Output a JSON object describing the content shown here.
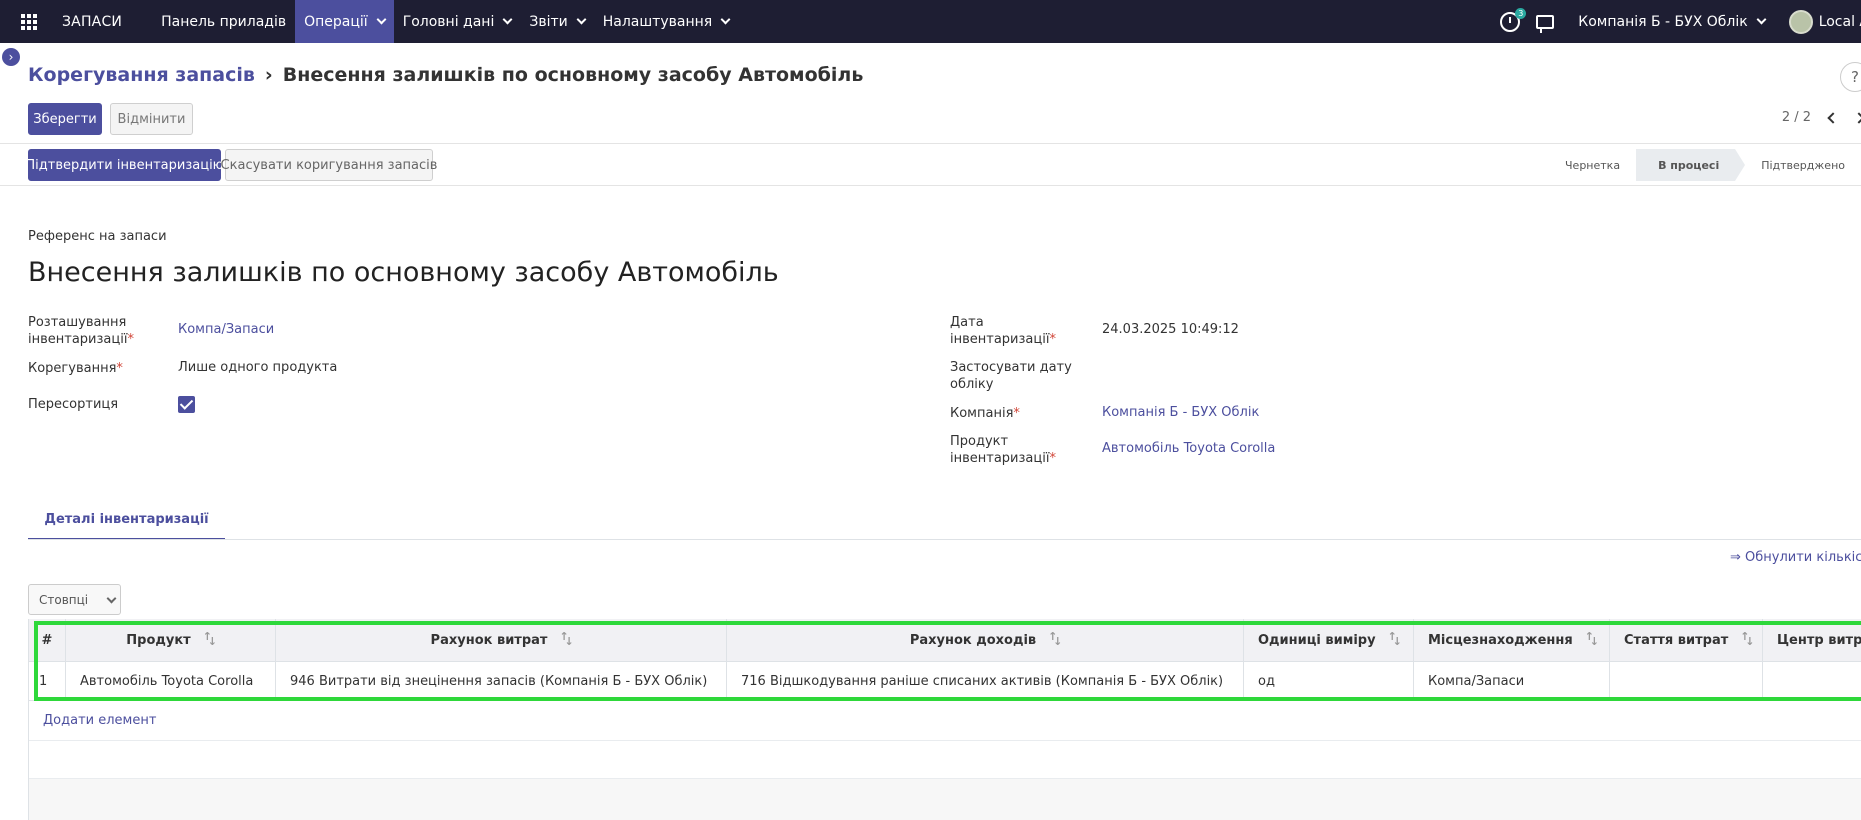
{
  "navbar": {
    "brand": "ЗАПАСИ",
    "items": [
      {
        "label": "Панель приладів"
      },
      {
        "label": "Операції"
      },
      {
        "label": "Головні дані"
      },
      {
        "label": "Звіти"
      },
      {
        "label": "Налаштування"
      }
    ],
    "activity_count": "3",
    "company": "Компанія Б - БУХ Облік",
    "user": "Local A"
  },
  "breadcrumb": {
    "parent": "Корегування запасів",
    "current": "Внесення залишків по основному засобу Автомобіль"
  },
  "buttons": {
    "save": "Зберегти",
    "discard": "Відмінити",
    "confirm": "Підтвердити інвентаризацію",
    "cancel": "Скасувати коригування запасів"
  },
  "pager": {
    "value": "2 / 2"
  },
  "status": {
    "stages": [
      "Чернетка",
      "В процесі",
      "Підтверджено"
    ],
    "current": "В процесі"
  },
  "form": {
    "ref_label": "Референс на запаси",
    "title": "Внесення залишків по основному засобу Автомобіль",
    "left": {
      "location_label_1": "Розташування",
      "location_label_2": "інвентаризації",
      "location_value": "Компа/Запаси",
      "adjustment_label": "Корегування",
      "adjustment_value": "Лише одного продукта",
      "regrading_label": "Пересортиця",
      "regrading_checked": true
    },
    "right": {
      "date_label_1": "Дата",
      "date_label_2": "інвентаризації",
      "date_value": "24.03.2025 10:49:12",
      "accounting_date_label_1": "Застосувати дату",
      "accounting_date_label_2": "обліку",
      "company_label": "Компанія",
      "company_value": "Компанія Б - БУХ Облік",
      "product_label_1": "Продукт",
      "product_label_2": "інвентаризації",
      "product_value": "Автомобіль Toyota Corolla"
    }
  },
  "notebook": {
    "tab": "Деталі інвентаризації",
    "reset_link": "⇒ Обнулити кількість",
    "columns_button": "Стовпці"
  },
  "table": {
    "headers": [
      "#",
      "Продукт",
      "Рахунок витрат",
      "Рахунок доходів",
      "Одиниці виміру",
      "Місцезнаходження",
      "Стаття витрат",
      "Центр витрат"
    ],
    "rows": [
      [
        "1",
        "Автомобіль Toyota Corolla",
        "946 Витрати від знецінення запасів (Компанія Б - БУХ Облік)",
        "716 Відшкодування раніше списаних активів (Компанія Б - БУХ Облік)",
        "од",
        "Компа/Запаси",
        "",
        ""
      ]
    ],
    "add_line": "Додати елемент"
  },
  "colors": {
    "navbar": "#1e1e33",
    "primary": "#4c4f9e",
    "highlight": "#2ed83a"
  }
}
